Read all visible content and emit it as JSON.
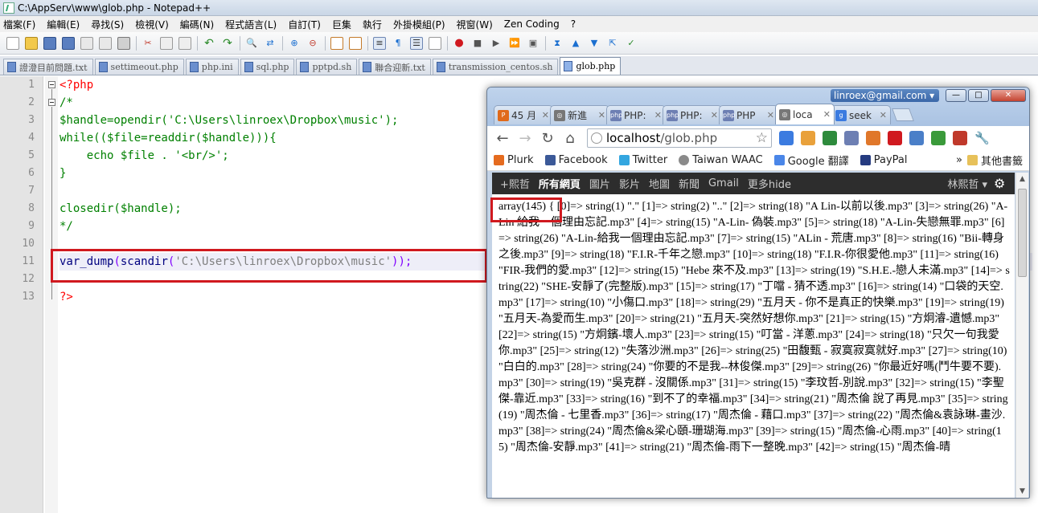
{
  "window": {
    "title": "C:\\AppServ\\www\\glob.php - Notepad++"
  },
  "menu": [
    "檔案(F)",
    "編輯(E)",
    "尋找(S)",
    "檢視(V)",
    "編碼(N)",
    "程式語言(L)",
    "自訂(T)",
    "巨集",
    "執行",
    "外掛模組(P)",
    "視窗(W)",
    "Zen Coding",
    "?"
  ],
  "tabs": [
    {
      "label": "證澄目前問題.txt"
    },
    {
      "label": "settimeout.php"
    },
    {
      "label": "php.ini"
    },
    {
      "label": "sql.php"
    },
    {
      "label": "pptpd.sh"
    },
    {
      "label": "聯合迎新.txt"
    },
    {
      "label": "transmission_centos.sh"
    },
    {
      "label": "glob.php",
      "active": true
    }
  ],
  "editor": {
    "line_numbers": [
      "1",
      "2",
      "3",
      "4",
      "5",
      "6",
      "7",
      "8",
      "9",
      "10",
      "11",
      "12",
      "13"
    ],
    "lines": {
      "l1": "<?php",
      "l2": "/*",
      "l3": "$handle=opendir('C:\\Users\\linroex\\Dropbox\\music');",
      "l4": "while(($file=readdir($handle))){",
      "l5": "    echo $file . '<br/>';",
      "l6": "}",
      "l8": "closedir($handle);",
      "l9": "*/",
      "l11_fn": "var_dump",
      "l11_p1": "(",
      "l11_fn2": "scandir",
      "l11_p2": "(",
      "l11_str": "'C:\\Users\\linroex\\Dropbox\\music'",
      "l11_p3": "));",
      "l13": "?>"
    }
  },
  "browser": {
    "account": "linroex@gmail.com",
    "tabs": [
      {
        "label": "45 月",
        "color": "#e06a1b",
        "glyph": "P"
      },
      {
        "label": "新進",
        "color": "#777777",
        "glyph": "◎"
      },
      {
        "label": "PHP:",
        "color": "#6d7fb3",
        "glyph": "php"
      },
      {
        "label": "PHP:",
        "color": "#6d7fb3",
        "glyph": "php"
      },
      {
        "label": "PHP",
        "color": "#6d7fb3",
        "glyph": "php"
      },
      {
        "label": "loca",
        "color": "#777777",
        "glyph": "◎",
        "active": true
      },
      {
        "label": "seek",
        "color": "#3b7be0",
        "glyph": "g"
      }
    ],
    "url_host": "localhost",
    "url_path": "/glob.php",
    "bookmarks": [
      {
        "label": "Plurk",
        "color": "#e56b1f"
      },
      {
        "label": "Facebook",
        "color": "#3b5998"
      },
      {
        "label": "Twitter",
        "color": "#33a6e0"
      },
      {
        "label": "Taiwan WAAC",
        "color": "#8a8a8a"
      },
      {
        "label": "Google 翻譯",
        "color": "#4a86e8"
      },
      {
        "label": "PayPal",
        "color": "#253b80"
      }
    ],
    "bookmarks_more": "»",
    "other_bookmarks": "其他書籤",
    "google_bar": {
      "items": [
        "+熙哲",
        "所有網頁",
        "圖片",
        "影片",
        "地圖",
        "新聞",
        "Gmail",
        "更多hide"
      ],
      "active_index": 1,
      "user": "林熙哲 ▾"
    },
    "output": "array(145) { [0]=> string(1) \".\" [1]=> string(2) \"..\" [2]=> string(18) \"A Lin-以前以後.mp3\" [3]=> string(26) \"A-Lin 給我一個理由忘記.mp3\" [4]=> string(15) \"A-Lin- 偽裝.mp3\" [5]=> string(18) \"A-Lin-失戀無罪.mp3\" [6]=> string(26) \"A-Lin-給我一個理由忘記.mp3\" [7]=> string(15) \"ALin - 荒唐.mp3\" [8]=> string(16) \"Bii-轉身之後.mp3\" [9]=> string(18) \"F.I.R-千年之戀.mp3\" [10]=> string(18) \"F.I.R-你很愛他.mp3\" [11]=> string(16) \"FIR-我們的愛.mp3\" [12]=> string(15) \"Hebe 來不及.mp3\" [13]=> string(19) \"S.H.E.-戀人未滿.mp3\" [14]=> string(22) \"SHE-安靜了(完整版).mp3\" [15]=> string(17) \"丁噹 - 猜不透.mp3\" [16]=> string(14) \"口袋的天空.mp3\" [17]=> string(10) \"小傷口.mp3\" [18]=> string(29) \"五月天 - 你不是真正的快樂.mp3\" [19]=> string(19) \"五月天-為愛而生.mp3\" [20]=> string(21) \"五月天-突然好想你.mp3\" [21]=> string(15) \"方炯濬-遺憾.mp3\" [22]=> string(15) \"方炯鑌-壞人.mp3\" [23]=> string(15) \"叮當 - 洋蔥.mp3\" [24]=> string(18) \"只欠一句我愛你.mp3\" [25]=> string(12) \"失落沙洲.mp3\" [26]=> string(25) \"田馥甄 - 寂寞寂寞就好.mp3\" [27]=> string(10) \"白白的.mp3\" [28]=> string(24) \"你要的不是我--林俊傑.mp3\" [29]=> string(26) \"你最近好嗎(鬥牛要不要).mp3\" [30]=> string(19) \"吳克群 - 沒關係.mp3\" [31]=> string(15) \"李玟哲-別說.mp3\" [32]=> string(15) \"李聖傑-靠近.mp3\" [33]=> string(16) \"到不了的幸福.mp3\" [34]=> string(21) \"周杰倫 說了再見.mp3\" [35]=> string(19) \"周杰倫 - 七里香.mp3\" [36]=> string(17) \"周杰倫 - 藉口.mp3\" [37]=> string(22) \"周杰倫&袁詠琳-畫沙.mp3\" [38]=> string(24) \"周杰倫&梁心頤-珊瑚海.mp3\" [39]=> string(15) \"周杰倫-心雨.mp3\" [40]=> string(15) \"周杰倫-安靜.mp3\" [41]=> string(21) \"周杰倫-雨下一整晚.mp3\" [42]=> string(15) \"周杰倫-晴"
  },
  "colors": {
    "highlight_box": "#d0191f",
    "comment": "#008000",
    "php_tag": "#ff0000"
  }
}
